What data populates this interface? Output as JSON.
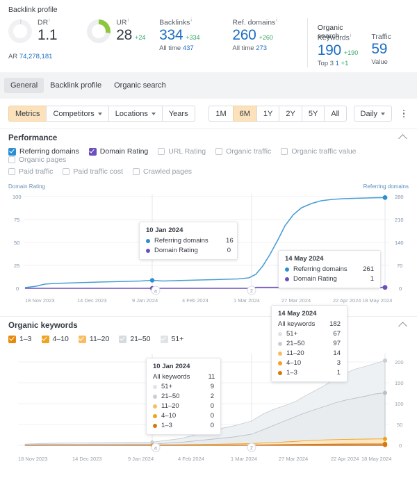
{
  "backlink_profile": {
    "title": "Backlink profile",
    "metrics": [
      {
        "label": "DR",
        "value": "1.1",
        "delta": "",
        "sub_label": "AR",
        "sub_value": "74,278,181",
        "sub_plus": "",
        "donut": true,
        "donut_pct": 2,
        "donut_color": "#f0f1f2",
        "value_color": "dark"
      },
      {
        "label": "UR",
        "value": "28",
        "delta": "+24",
        "sub_label": "",
        "sub_value": "",
        "sub_plus": "",
        "donut": true,
        "donut_pct": 28,
        "donut_color": "#8ec63f",
        "value_color": "dark"
      },
      {
        "label": "Backlinks",
        "value": "334",
        "delta": "+334",
        "sub_label": "All time",
        "sub_value": "437",
        "sub_plus": "",
        "donut": false,
        "value_color": "blue"
      },
      {
        "label": "Ref. domains",
        "value": "260",
        "delta": "+260",
        "sub_label": "All time",
        "sub_value": "273",
        "sub_plus": "",
        "donut": false,
        "value_color": "blue"
      }
    ]
  },
  "organic_search": {
    "title": "Organic search",
    "metrics": [
      {
        "label": "Keywords",
        "value": "190",
        "delta": "+190",
        "sub_label": "Top 3",
        "sub_value": "1",
        "sub_plus": "+1",
        "donut": false,
        "value_color": "blue"
      },
      {
        "label": "Traffic",
        "value": "59",
        "delta": "",
        "sub_label": "Value",
        "sub_value": "",
        "sub_plus": "",
        "donut": false,
        "value_color": "blue"
      }
    ]
  },
  "tabs": [
    {
      "label": "General",
      "active": true
    },
    {
      "label": "Backlink profile",
      "active": false
    },
    {
      "label": "Organic search",
      "active": false
    }
  ],
  "toolbar": {
    "left_buttons": [
      {
        "label": "Metrics",
        "caret": false,
        "highlight": true
      },
      {
        "label": "Competitors",
        "caret": true,
        "highlight": false
      },
      {
        "label": "Locations",
        "caret": true,
        "highlight": false
      },
      {
        "label": "Years",
        "caret": false,
        "highlight": false
      }
    ],
    "ranges": [
      {
        "label": "1M",
        "active": false
      },
      {
        "label": "6M",
        "active": true
      },
      {
        "label": "1Y",
        "active": false
      },
      {
        "label": "2Y",
        "active": false
      },
      {
        "label": "5Y",
        "active": false
      },
      {
        "label": "All",
        "active": false
      }
    ],
    "granularity": "Daily",
    "more_label": "More options"
  },
  "performance": {
    "title": "Performance",
    "checkboxes": [
      {
        "label": "Referring domains",
        "checked": true,
        "color": "#2a8fd4"
      },
      {
        "label": "Domain Rating",
        "checked": true,
        "color": "#6a4fbd"
      },
      {
        "label": "URL Rating",
        "checked": false,
        "color": ""
      },
      {
        "label": "Organic traffic",
        "checked": false,
        "color": ""
      },
      {
        "label": "Organic traffic value",
        "checked": false,
        "color": ""
      },
      {
        "label": "Organic pages",
        "checked": false,
        "color": ""
      },
      {
        "label": "Paid traffic",
        "checked": false,
        "color": ""
      },
      {
        "label": "Paid traffic cost",
        "checked": false,
        "color": ""
      },
      {
        "label": "Crawled pages",
        "checked": false,
        "color": ""
      }
    ],
    "tooltips": [
      {
        "date": "10 Jan 2024",
        "rows": [
          {
            "name": "Referring domains",
            "value": "16",
            "color": "#2a8fd4"
          },
          {
            "name": "Domain Rating",
            "value": "0",
            "color": "#6a4fbd"
          }
        ]
      },
      {
        "date": "14 May 2024",
        "rows": [
          {
            "name": "Referring domains",
            "value": "261",
            "color": "#2a8fd4"
          },
          {
            "name": "Domain Rating",
            "value": "1",
            "color": "#6a4fbd"
          }
        ]
      }
    ],
    "markers": [
      {
        "label": "a"
      },
      {
        "label": "2"
      }
    ]
  },
  "organic_keywords": {
    "title": "Organic keywords",
    "checkboxes": [
      {
        "label": "1–3",
        "checked": true,
        "color": "#e8890c"
      },
      {
        "label": "4–10",
        "checked": true,
        "color": "#f0a31e"
      },
      {
        "label": "11–20",
        "checked": true,
        "color": "#f7bd60"
      },
      {
        "label": "21–50",
        "checked": false,
        "color": "#c9ced3"
      },
      {
        "label": "51+",
        "checked": false,
        "color": "#dfe3e6"
      }
    ],
    "tooltips": [
      {
        "date": "10 Jan 2024",
        "total_label": "All keywords",
        "total_value": "11",
        "rows": [
          {
            "name": "51+",
            "value": "9",
            "color": "#dfe3e6"
          },
          {
            "name": "21–50",
            "value": "2",
            "color": "#c9ced3"
          },
          {
            "name": "11–20",
            "value": "0",
            "color": "#f7bd60"
          },
          {
            "name": "4–10",
            "value": "0",
            "color": "#f0a31e"
          },
          {
            "name": "1–3",
            "value": "0",
            "color": "#d97706"
          }
        ]
      },
      {
        "date": "14 May 2024",
        "total_label": "All keywords",
        "total_value": "182",
        "rows": [
          {
            "name": "51+",
            "value": "67",
            "color": "#dfe3e6"
          },
          {
            "name": "21–50",
            "value": "97",
            "color": "#c9ced3"
          },
          {
            "name": "11–20",
            "value": "14",
            "color": "#f7bd60"
          },
          {
            "name": "4–10",
            "value": "3",
            "color": "#f0a31e"
          },
          {
            "name": "1–3",
            "value": "1",
            "color": "#d97706"
          }
        ]
      }
    ]
  },
  "chart_data": [
    {
      "type": "line",
      "title": "Performance",
      "ylabel": "Domain Rating",
      "y2label": "Referring domains",
      "xlabel": "",
      "grid": true,
      "legend": "top",
      "x_ticks": [
        "18 Nov 2023",
        "14 Dec 2023",
        "9 Jan 2024",
        "4 Feb 2024",
        "1 Mar 2024",
        "27 Mar 2024",
        "22 Apr 2024",
        "18 May 2024"
      ],
      "y_ticks": [
        0,
        25,
        50,
        75,
        100
      ],
      "ylim": [
        0,
        100
      ],
      "y2_ticks": [
        0,
        70,
        140,
        210,
        280
      ],
      "y2lim": [
        0,
        280
      ],
      "series": [
        {
          "name": "Referring domains",
          "color": "#4a9ed4",
          "axis": "right",
          "x": [
            "18 Nov 2023",
            "25 Nov 2023",
            "2 Dec 2023",
            "9 Dec 2023",
            "14 Dec 2023",
            "21 Dec 2023",
            "28 Dec 2023",
            "4 Jan 2024",
            "10 Jan 2024",
            "17 Jan 2024",
            "24 Jan 2024",
            "31 Jan 2024",
            "4 Feb 2024",
            "11 Feb 2024",
            "18 Feb 2024",
            "25 Feb 2024",
            "1 Mar 2024",
            "8 Mar 2024",
            "15 Mar 2024",
            "22 Mar 2024",
            "27 Mar 2024",
            "3 Apr 2024",
            "10 Apr 2024",
            "17 Apr 2024",
            "22 Apr 2024",
            "29 Apr 2024",
            "6 May 2024",
            "14 May 2024",
            "18 May 2024"
          ],
          "values": [
            1,
            6,
            10,
            12,
            13,
            13,
            14,
            15,
            16,
            17,
            18,
            19,
            20,
            21,
            22,
            24,
            28,
            60,
            120,
            180,
            215,
            235,
            246,
            252,
            256,
            258,
            260,
            261,
            261
          ]
        },
        {
          "name": "Domain Rating",
          "color": "#6a4fbd",
          "axis": "left",
          "x": [
            "18 Nov 2023",
            "10 Jan 2024",
            "1 Mar 2024",
            "27 Mar 2024",
            "14 May 2024",
            "18 May 2024"
          ],
          "values": [
            0,
            0,
            0,
            1,
            1,
            1
          ]
        }
      ],
      "annotations": [
        {
          "date": "10 Jan 2024",
          "label": "a"
        },
        {
          "date": "1 Mar 2024",
          "label": "2"
        }
      ]
    },
    {
      "type": "area",
      "title": "Organic keywords",
      "ylabel": "",
      "y2label": "",
      "grid": true,
      "stacked": true,
      "x_ticks": [
        "18 Nov 2023",
        "14 Dec 2023",
        "9 Jan 2024",
        "4 Feb 2024",
        "1 Mar 2024",
        "27 Mar 2024",
        "22 Apr 2024",
        "18 May 2024"
      ],
      "y2_ticks": [
        0,
        50,
        100,
        150,
        200
      ],
      "y2lim": [
        0,
        210
      ],
      "series": [
        {
          "name": "51+",
          "color": "#dfe3e6",
          "x": [
            "18 Nov 2023",
            "14 Dec 2023",
            "9 Jan 2024",
            "10 Jan 2024",
            "4 Feb 2024",
            "1 Mar 2024",
            "15 Mar 2024",
            "27 Mar 2024",
            "10 Apr 2024",
            "22 Apr 2024",
            "6 May 2024",
            "14 May 2024",
            "18 May 2024"
          ],
          "values": [
            2,
            5,
            9,
            9,
            14,
            30,
            48,
            62,
            74,
            80,
            75,
            67,
            70
          ]
        },
        {
          "name": "21–50",
          "color": "#c9ced3",
          "x": [
            "18 Nov 2023",
            "14 Dec 2023",
            "9 Jan 2024",
            "10 Jan 2024",
            "4 Feb 2024",
            "1 Mar 2024",
            "15 Mar 2024",
            "27 Mar 2024",
            "10 Apr 2024",
            "22 Apr 2024",
            "6 May 2024",
            "14 May 2024",
            "18 May 2024"
          ],
          "values": [
            1,
            2,
            2,
            2,
            6,
            14,
            30,
            52,
            74,
            88,
            94,
            97,
            99
          ]
        },
        {
          "name": "11–20",
          "color": "#f7bd60",
          "x": [
            "18 Nov 2023",
            "14 Dec 2023",
            "9 Jan 2024",
            "10 Jan 2024",
            "4 Feb 2024",
            "1 Mar 2024",
            "15 Mar 2024",
            "27 Mar 2024",
            "10 Apr 2024",
            "22 Apr 2024",
            "6 May 2024",
            "14 May 2024",
            "18 May 2024"
          ],
          "values": [
            0,
            0,
            0,
            0,
            1,
            2,
            4,
            6,
            9,
            11,
            13,
            14,
            14
          ]
        },
        {
          "name": "4–10",
          "color": "#f0a31e",
          "x": [
            "18 Nov 2023",
            "14 Dec 2023",
            "9 Jan 2024",
            "10 Jan 2024",
            "4 Feb 2024",
            "1 Mar 2024",
            "15 Mar 2024",
            "27 Mar 2024",
            "10 Apr 2024",
            "22 Apr 2024",
            "6 May 2024",
            "14 May 2024",
            "18 May 2024"
          ],
          "values": [
            0,
            0,
            0,
            0,
            0,
            0,
            1,
            1,
            2,
            3,
            3,
            3,
            3
          ]
        },
        {
          "name": "1–3",
          "color": "#d97706",
          "x": [
            "18 Nov 2023",
            "14 Dec 2023",
            "9 Jan 2024",
            "10 Jan 2024",
            "4 Feb 2024",
            "1 Mar 2024",
            "15 Mar 2024",
            "27 Mar 2024",
            "10 Apr 2024",
            "22 Apr 2024",
            "6 May 2024",
            "14 May 2024",
            "18 May 2024"
          ],
          "values": [
            0,
            0,
            0,
            0,
            0,
            0,
            0,
            0,
            1,
            1,
            1,
            1,
            1
          ]
        }
      ],
      "annotations": [
        {
          "date": "10 Jan 2024",
          "label": "a"
        },
        {
          "date": "1 Mar 2024",
          "label": "2"
        }
      ]
    }
  ]
}
